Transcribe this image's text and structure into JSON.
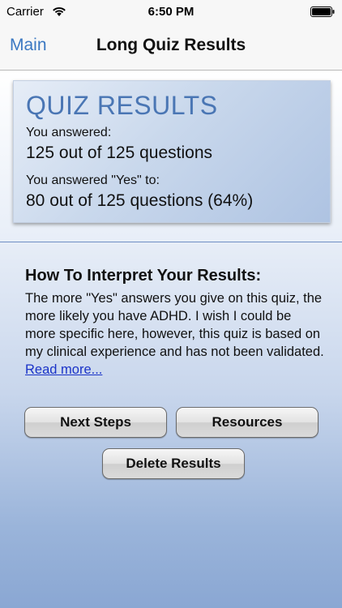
{
  "status_bar": {
    "carrier": "Carrier",
    "time": "6:50 PM",
    "wifi_icon": "wifi-icon",
    "battery_icon": "battery-icon"
  },
  "nav": {
    "back_label": "Main",
    "title": "Long Quiz Results"
  },
  "results": {
    "title": "QUIZ RESULTS",
    "answered_label": "You answered:",
    "answered_value": "125 out of 125 questions",
    "yes_label": "You answered \"Yes\" to:",
    "yes_value": "80 out of 125 questions (64%)"
  },
  "interpret": {
    "heading": "How To Interpret Your Results:",
    "body": "The more \"Yes\" answers you give on this quiz, the more likely you have ADHD. I wish I could be more specific here, however, this quiz is based on my clinical experience and has not been validated.",
    "read_more": "Read more..."
  },
  "buttons": {
    "next_steps": "Next Steps",
    "resources": "Resources",
    "delete_results": "Delete Results"
  },
  "colors": {
    "accent": "#3b78c2",
    "title_blue": "#4a76b4",
    "link": "#1a33c8"
  }
}
